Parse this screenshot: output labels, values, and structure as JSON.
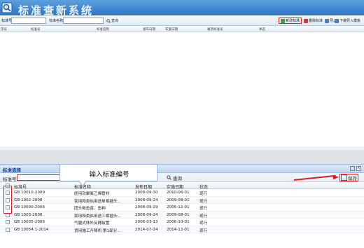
{
  "app": {
    "title": "标准查新系统",
    "logo_icon": "app-logo-icon"
  },
  "toolbar": {
    "code_label": "标准号",
    "name_label": "标准名称",
    "query_label": "查询",
    "new_std": "新增标准",
    "delete_std": "删除标准",
    "import": "导入",
    "download_template": "下载导入模板"
  },
  "main_grid": {
    "columns": [
      "序号",
      "标准号",
      "标准名称",
      "发布日期",
      "实施日期",
      "被新标准号",
      "状态"
    ]
  },
  "dialog": {
    "title": "标准选择",
    "code_label": "标准号",
    "query_label": "查询",
    "save_label": "保存",
    "columns": [
      "标准号",
      "标准名称",
      "发布日期",
      "实施日期",
      "状态"
    ],
    "rows": [
      {
        "code": "GB 10010-2009",
        "name": "医用软聚氯乙烯管材",
        "publish": "2009-09-30",
        "effective": "2010-06-01",
        "status": "现行"
      },
      {
        "code": "GB 1002-2008",
        "name": "家用和类似用途单相插头...",
        "publish": "2008-09-24",
        "effective": "2009-08-01",
        "status": "现行"
      },
      {
        "code": "GB 10030-2006",
        "name": "团头鲂鱼苗、鱼种",
        "publish": "2006-09-29",
        "effective": "2006-12-01",
        "status": "现行"
      },
      {
        "code": "GB 1003-2008",
        "name": "家用和类似用途三相插头...",
        "publish": "2008-09-24",
        "effective": "2009-08-01",
        "status": "现行"
      },
      {
        "code": "GB 10035-2006",
        "name": "气腹式体外反搏装置",
        "publish": "2006-03-13",
        "effective": "2006-10-01",
        "status": "现行"
      },
      {
        "code": "GB 10054.1-2014",
        "name": "货用施工升降机 第1部分...",
        "publish": "2014-07-24",
        "effective": "2014-12-01",
        "status": "现行"
      }
    ]
  },
  "callout": {
    "text": "输入标准编号"
  },
  "colors": {
    "accent": "#2f74c4",
    "highlight": "#e21b1b"
  }
}
